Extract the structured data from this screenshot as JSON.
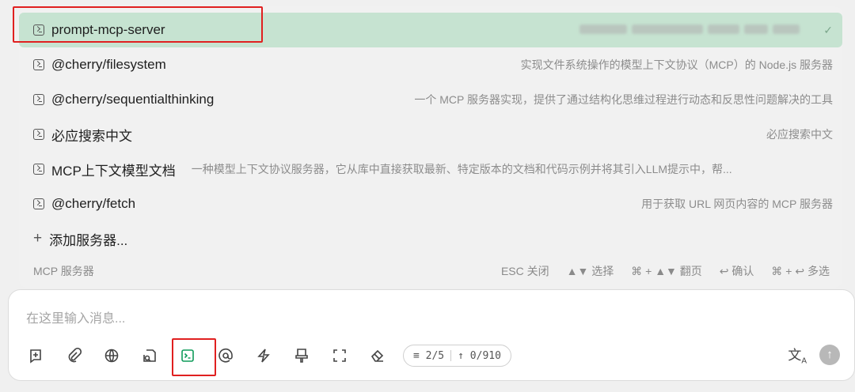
{
  "popup": {
    "items": [
      {
        "name": "prompt-mcp-server",
        "desc": "",
        "selected": true
      },
      {
        "name": "@cherry/filesystem",
        "desc": "实现文件系统操作的模型上下文协议（MCP）的 Node.js 服务器"
      },
      {
        "name": "@cherry/sequentialthinking",
        "desc": "一个 MCP 服务器实现，提供了通过结构化思维过程进行动态和反思性问题解决的工具"
      },
      {
        "name": "必应搜索中文",
        "desc": "必应搜索中文"
      },
      {
        "name": "MCP上下文模型文档",
        "desc": "一种模型上下文协议服务器，它从库中直接获取最新、特定版本的文档和代码示例并将其引入LLM提示中，帮..."
      },
      {
        "name": "@cherry/fetch",
        "desc": "用于获取 URL 网页内容的 MCP 服务器"
      }
    ],
    "add_label": "添加服务器...",
    "add_icon": "plus-icon",
    "footer_title": "MCP 服务器",
    "hints": [
      "ESC 关闭",
      "▲▼ 选择",
      "⌘ + ▲▼ 翻页",
      "↩ 确认",
      "⌘ + ↩ 多选"
    ],
    "check_icon": "check-icon"
  },
  "input": {
    "placeholder": "在这里输入消息...",
    "tools": [
      "new-topic-icon",
      "attachment-icon",
      "web-search-icon",
      "knowledge-base-icon",
      "mcp-server-icon",
      "mention-icon",
      "quick-phrase-icon",
      "clear-icon",
      "expand-icon",
      "eraser-icon"
    ],
    "counter_context": "2/5",
    "counter_tokens": "0/910",
    "translate_icon": "translate-icon",
    "send_icon": "send-icon"
  },
  "colors": {
    "selected_bg": "#c6e3d1",
    "highlight": "#e02020",
    "accent": "#00b96b"
  }
}
